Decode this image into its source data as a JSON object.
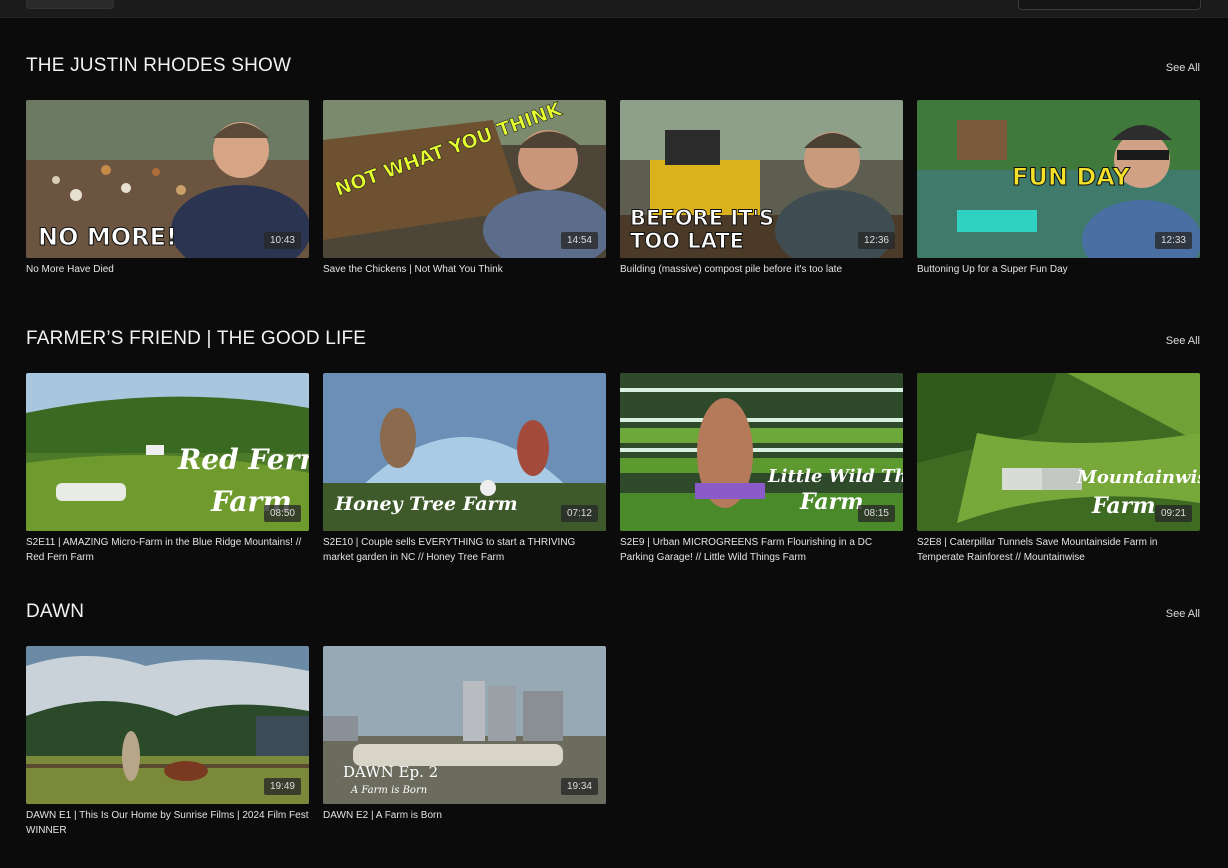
{
  "sections": [
    {
      "title": "THE JUSTIN RHODES SHOW",
      "see_all": "See All",
      "videos": [
        {
          "title": "No More Have Died",
          "duration": "10:43",
          "overlay": "NO MORE!"
        },
        {
          "title": "Save the Chickens | Not What You Think",
          "duration": "14:54",
          "overlay": "NOT WHAT YOU THINK"
        },
        {
          "title": "Building (massive) compost pile before it's too late",
          "duration": "12:36",
          "overlay_line1": "BEFORE IT'S",
          "overlay_line2": "TOO LATE"
        },
        {
          "title": "Buttoning Up for a Super Fun Day",
          "duration": "12:33",
          "overlay": "FUN DAY"
        }
      ]
    },
    {
      "title": "FARMER’S FRIEND | THE GOOD LIFE",
      "see_all": "See All",
      "videos": [
        {
          "title": "S2E11 | AMAZING Micro-Farm in the Blue Ridge Mountains! // Red Fern Farm",
          "duration": "08:50",
          "overlay_line1": "Red Fern",
          "overlay_line2": "Farm"
        },
        {
          "title": "S2E10 | Couple sells EVERYTHING to start a THRIVING market garden in NC // Honey Tree Farm",
          "duration": "07:12",
          "overlay": "Honey Tree Farm"
        },
        {
          "title": "S2E9 | Urban MICROGREENS Farm Flourishing in a DC Parking Garage! // Little Wild Things Farm",
          "duration": "08:15",
          "overlay_line1": "Little Wild Things",
          "overlay_line2": "Farm"
        },
        {
          "title": "S2E8 | Caterpillar Tunnels Save Mountainside Farm in Temperate Rainforest // Mountainwise",
          "duration": "09:21",
          "overlay_line1": "Mountainwise",
          "overlay_line2": "Farm"
        }
      ]
    },
    {
      "title": "DAWN",
      "see_all": "See All",
      "videos": [
        {
          "title": "DAWN E1 | This Is Our Home by Sunrise Films | 2024 Film Fest WINNER",
          "duration": "19:49"
        },
        {
          "title": "DAWN E2 | A Farm is Born",
          "duration": "19:34",
          "overlay_line1": "DAWN Ep. 2",
          "overlay_line2": "A Farm is Born"
        }
      ]
    }
  ]
}
